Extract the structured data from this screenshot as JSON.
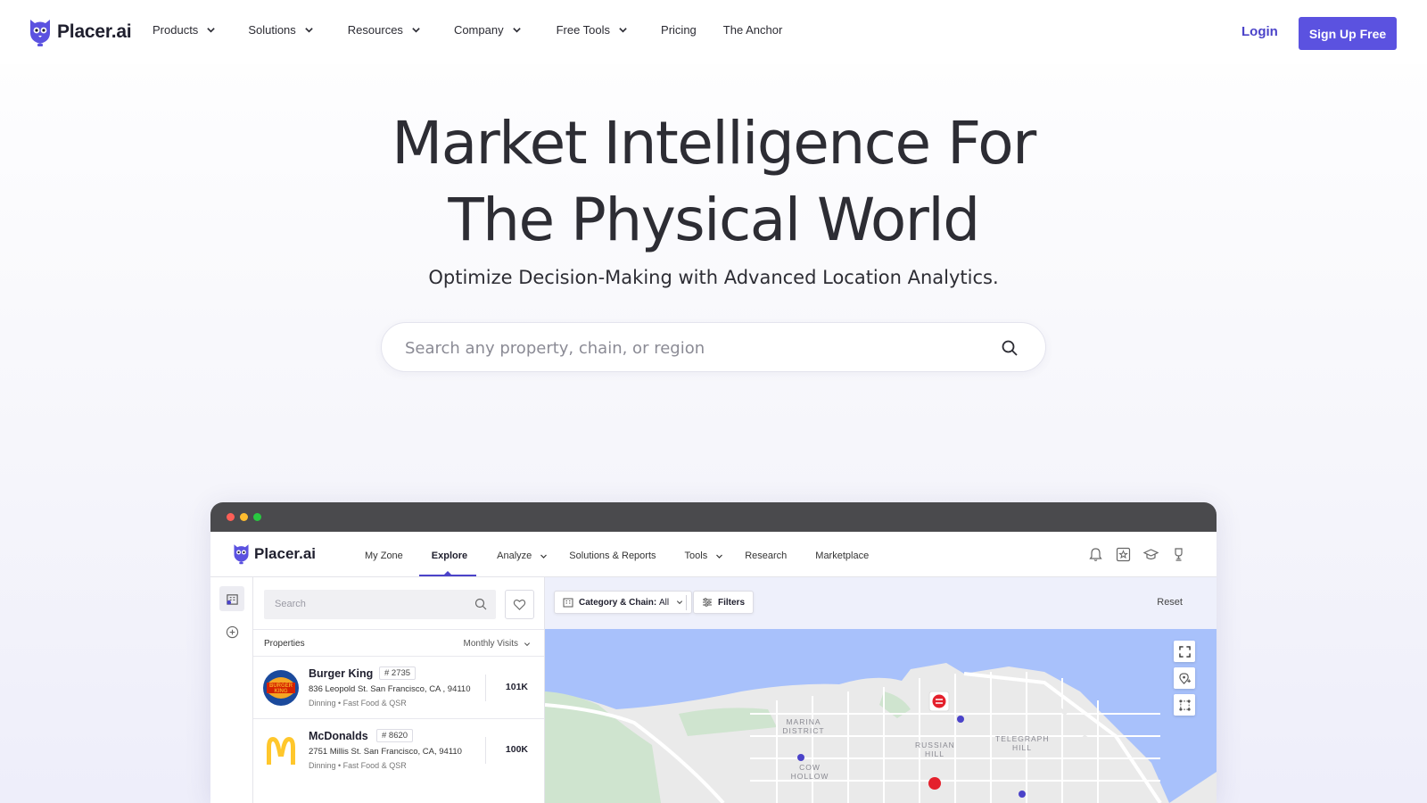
{
  "nav": {
    "logo_text": "Placer.ai",
    "items": [
      {
        "label": "Products",
        "dropdown": true
      },
      {
        "label": "Solutions",
        "dropdown": true
      },
      {
        "label": "Resources",
        "dropdown": true
      },
      {
        "label": "Company",
        "dropdown": true
      },
      {
        "label": "Free Tools",
        "dropdown": true
      },
      {
        "label": "Pricing",
        "dropdown": false
      },
      {
        "label": "The Anchor",
        "dropdown": false
      }
    ],
    "login_label": "Login",
    "signup_label": "Sign Up Free"
  },
  "hero": {
    "title_line1": "Market Intelligence For",
    "title_line2": "The Physical World",
    "subtitle": "Optimize Decision-Making with Advanced Location Analytics.",
    "search_placeholder": "Search any property, chain, or region"
  },
  "app": {
    "logo_text": "Placer.ai",
    "menu": [
      {
        "label": "My Zone",
        "dropdown": false,
        "active": false
      },
      {
        "label": "Explore",
        "dropdown": false,
        "active": true
      },
      {
        "label": "Analyze",
        "dropdown": true,
        "active": false
      },
      {
        "label": "Solutions & Reports",
        "dropdown": false,
        "active": false
      },
      {
        "label": "Tools",
        "dropdown": true,
        "active": false
      },
      {
        "label": "Research",
        "dropdown": false,
        "active": false
      },
      {
        "label": "Marketplace",
        "dropdown": false,
        "active": false
      }
    ],
    "panel": {
      "search_placeholder": "Search",
      "list_label": "Properties",
      "sort_label": "Monthly Visits",
      "properties": [
        {
          "name": "Burger King",
          "number": "# 2735",
          "address": "836 Leopold St. San Francisco, CA , 94110",
          "category": "Dinning • Fast Food & QSR",
          "visits": "101K",
          "logo": "burger-king-logo"
        },
        {
          "name": "McDonalds",
          "number": "# 8620",
          "address": "2751 Millis St. San Francisco, CA, 94110",
          "category": "Dinning • Fast Food & QSR",
          "visits": "100K",
          "logo": "mcdonalds-logo"
        }
      ]
    },
    "filters": {
      "category_prefix": "Category & Chain:",
      "category_value": "All",
      "filters_label": "Filters",
      "reset_label": "Reset"
    },
    "map": {
      "labels": [
        "MARINA DISTRICT",
        "RUSSIAN HILL",
        "COW HOLLOW",
        "TELEGRAPH HILL"
      ],
      "water_color": "#a8c1fb",
      "land_color": "#eaeaea"
    }
  },
  "colors": {
    "brand": "#5b52e0",
    "brand_text": "#4b43c9"
  }
}
